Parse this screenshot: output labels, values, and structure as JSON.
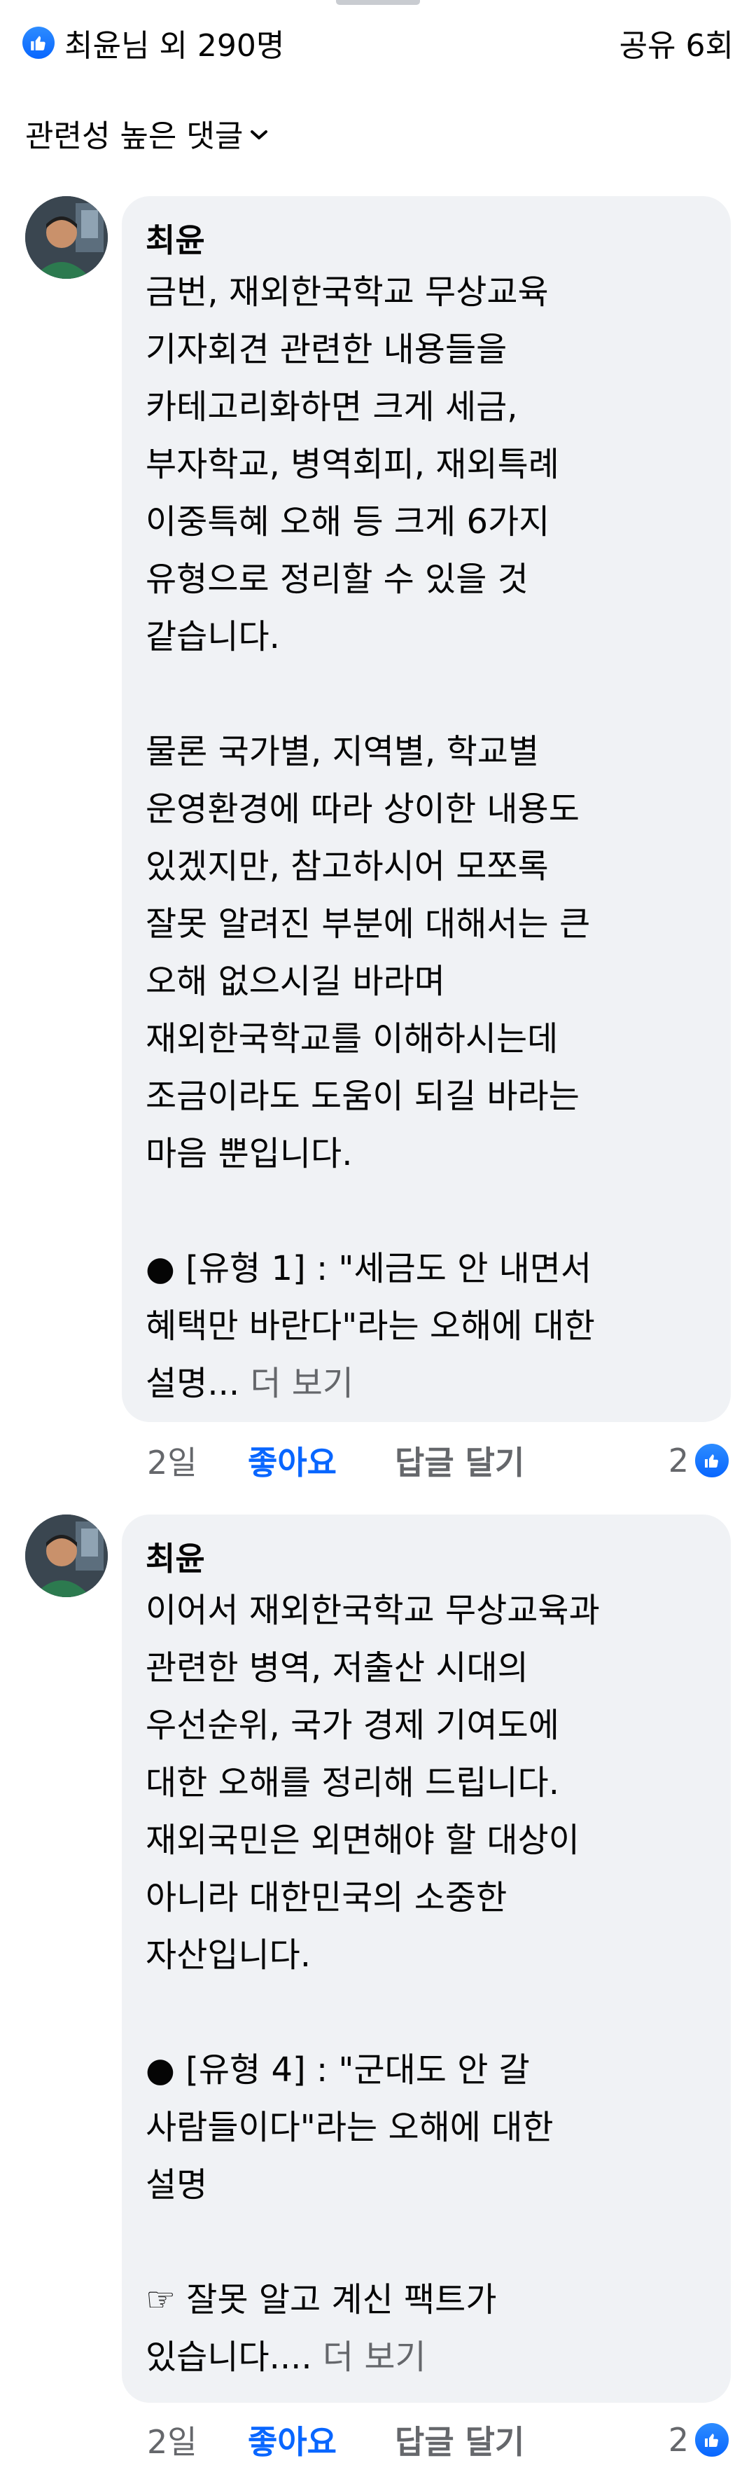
{
  "summary": {
    "reactions_text": "최윤님 외 290명",
    "shares_text": "공유 6회",
    "reaction_icon": "thumbs-up-icon"
  },
  "sort": {
    "label": "관련성 높은 댓글",
    "icon": "chevron-down-icon"
  },
  "comments": [
    {
      "author": "최윤",
      "body": "금번, 재외한국학교 무상교육\n기자회견 관련한 내용들을\n카테고리화하면 크게 세금,\n부자학교, 병역회피, 재외특례\n이중특혜 오해 등 크게 6가지\n유형으로 정리할 수 있을 것\n같습니다.\n\n물론 국가별, 지역별, 학교별\n운영환경에 따라 상이한 내용도\n있겠지만, 참고하시어 모쪼록\n잘못 알려진 부분에 대해서는 큰\n오해 없으시길 바라며\n재외한국학교를 이해하시는데\n조금이라도 도움이 되길 바라는\n마음 뿐입니다.\n\n● [유형 1] : \"세금도 안 내면서\n혜택만 바란다\"라는 오해에 대한\n설명...",
      "see_more": " 더 보기",
      "time": "2일",
      "like_label": "좋아요",
      "reply_label": "답글 달기",
      "reaction_count": "2"
    },
    {
      "author": "최윤",
      "body": "이어서 재외한국학교 무상교육과\n관련한 병역, 저출산 시대의\n우선순위, 국가 경제 기여도에\n대한 오해를 정리해 드립니다.\n재외국민은 외면해야 할 대상이\n아니라 대한민국의 소중한\n자산입니다.\n\n● [유형 4] : \"군대도 안 갈\n사람들이다\"라는 오해에 대한\n설명\n\n☞ 잘못 알고 계신 팩트가\n있습니다....",
      "see_more": " 더 보기",
      "time": "2일",
      "like_label": "좋아요",
      "reply_label": "답글 달기",
      "reaction_count": "2"
    }
  ],
  "colors": {
    "accent": "#0866ff",
    "bubble": "#f0f2f5",
    "secondary_text": "#65676b"
  }
}
